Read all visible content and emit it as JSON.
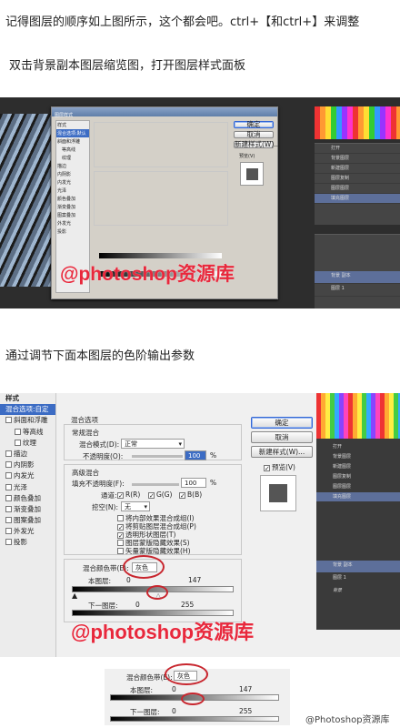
{
  "intro": {
    "line1": "记得图层的顺序如上图所示，这个都会吧。ctrl+【和ctrl+】来调整",
    "line2": "双击背景副本图层缩览图，打开图层样式面板",
    "line3": "通过调节下面本图层的色阶输出参数"
  },
  "watermark": "@photoshop资源库",
  "footer_credit": "@Photoshop资源库",
  "small_shot": {
    "dialog_title": "图层样式",
    "styles_header": "样式",
    "styles": [
      "混合选项:默认",
      "斜面和浮雕",
      "等高线",
      "纹理",
      "描边",
      "内阴影",
      "内发光",
      "光泽",
      "颜色叠加",
      "渐变叠加",
      "图案叠加",
      "外发光",
      "投影"
    ],
    "buttons": [
      "确定",
      "取消",
      "新建样式(W)...",
      "预览(V)"
    ],
    "layers": [
      "打开",
      "背景图层",
      "新建图层",
      "图层复制",
      "图层图层",
      "填充图层"
    ],
    "layer_rows": [
      "背景 副本",
      "图层 1"
    ]
  },
  "big_shot": {
    "styles_header": "样式",
    "styles": [
      {
        "label": "混合选项:自定",
        "selected": true,
        "check": false
      },
      {
        "label": "斜面和浮雕",
        "check": true
      },
      {
        "label": "等高线",
        "check": true,
        "indent": true
      },
      {
        "label": "纹理",
        "check": true,
        "indent": true
      },
      {
        "label": "描边",
        "check": true
      },
      {
        "label": "内阴影",
        "check": true
      },
      {
        "label": "内发光",
        "check": true
      },
      {
        "label": "光泽",
        "check": true
      },
      {
        "label": "颜色叠加",
        "check": true
      },
      {
        "label": "渐变叠加",
        "check": true
      },
      {
        "label": "图案叠加",
        "check": true
      },
      {
        "label": "外发光",
        "check": true
      },
      {
        "label": "投影",
        "check": true
      }
    ],
    "blend_options": "混合选项",
    "general": "常规混合",
    "mode_label": "混合模式(D):",
    "mode_value": "正常",
    "opacity_label": "不透明度(O):",
    "opacity_value": "100",
    "pct": "%",
    "advanced": "高级混合",
    "fill_label": "填充不透明度(F):",
    "fill_value": "100",
    "channels_label": "通道:",
    "channels": [
      "R(R)",
      "G(G)",
      "B(B)"
    ],
    "knockout_label": "挖空(N):",
    "knockout_value": "无",
    "options": [
      "将内部效果混合成组(I)",
      "将剪贴图层混合成组(P)",
      "透明形状图层(T)",
      "图层蒙版隐藏效果(S)",
      "矢量蒙版隐藏效果(H)"
    ],
    "options_checked": [
      false,
      true,
      true,
      false,
      false
    ],
    "blend_if_label": "混合颜色带(E):",
    "blend_if_value": "灰色",
    "this_layer": "本图层:",
    "this_layer_vals": [
      "0",
      "147"
    ],
    "underlying": "下一图层:",
    "underlying_vals": [
      "0",
      "255"
    ],
    "ok": "确定",
    "cancel": "取消",
    "new_style": "新建样式(W)...",
    "preview": "预览(V)",
    "layers": [
      "打开",
      "背景图层",
      "新建图层",
      "图层复制",
      "图层图层",
      "填充图层"
    ],
    "layer_rows": [
      "背景 副本",
      "图层 1",
      "背景"
    ]
  },
  "crop": {
    "blend_if_label": "混合颜色带(E):",
    "blend_if_value": "灰色",
    "this_layer": "本图层:",
    "this_layer_vals": [
      "0",
      "147"
    ],
    "underlying": "下一图层:",
    "underlying_vals": [
      "0",
      "255"
    ]
  },
  "colors": {
    "accent": "#3c6cc4",
    "watermark": "#e8283c",
    "annotation": "#c8262e"
  }
}
